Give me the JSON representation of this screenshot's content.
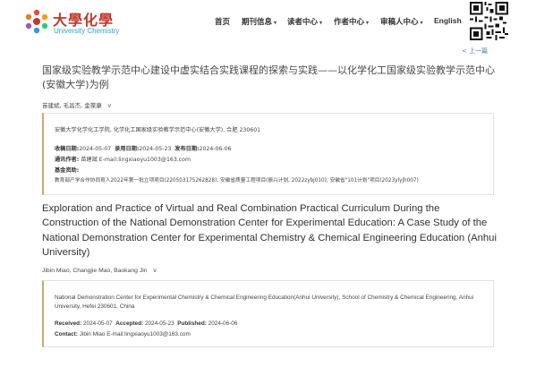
{
  "header": {
    "logo_cn": "大學化學",
    "logo_en": "University Chemistry",
    "nav": [
      {
        "label": "首页",
        "has_dropdown": false
      },
      {
        "label": "期刊信息",
        "has_dropdown": true
      },
      {
        "label": "读者中心",
        "has_dropdown": true
      },
      {
        "label": "作者中心",
        "has_dropdown": true
      },
      {
        "label": "审稿人中心",
        "has_dropdown": true
      },
      {
        "label": "English",
        "has_dropdown": false
      }
    ],
    "dropdown_caret": "▾",
    "prev_page": "< 上一篇"
  },
  "article_cn": {
    "title": "国家级实验教学示范中心建设中虚实结合实践课程的探索与实践——以化学化工国家级实验教学示范中心(安徽大学)为例",
    "authors": "苗建斌, 毛昌杰, 金葆康",
    "affiliation": "安徽大学化学化工学院, 化学化工国家级实验教学示范中心(安徽大学), 合肥 230601",
    "received_label": "收稿日期:",
    "received": "2024-05-07",
    "accepted_label": "录用日期:",
    "accepted": "2024-05-23",
    "published_label": "发布日期:",
    "published": "2024-06-06",
    "contact_label": "通讯作者:",
    "contact": "苗建斌 E-mail:lingxiaoyu1003@163.com",
    "funding_label": "基金资助:",
    "funding": "教育部产学合作协同育人2022年第一批立项项目(220503175262828); 安徽省质量工程项目(振兴计划, 2022zybj010); 安徽省\"101计划\"项目(2023ylyjh007)"
  },
  "article_en": {
    "title": "Exploration and Practice of Virtual and Real Combination Practical Curriculum During the Construction of the National Demonstration Center for Experimental Education: A Case Study of the National Demonstration Center for Experimental Chemistry & Chemical Engineering Education (Anhui University)",
    "authors": "Jibin Miao, Changjie Mao, Baokang Jin",
    "affiliation": "National Demonstration Center for Experimental Chemistry & Chemical Engineering Education(Anhui University), School of Chemistry & Chemical Engineering, Anhui University, Hefei 230601, China",
    "received_label": "Received:",
    "received": "2024-05-07",
    "accepted_label": "Accepted:",
    "accepted": "2024-05-23",
    "published_label": "Published:",
    "published": "2024-06-06",
    "contact_label": "Contact:",
    "contact": "Jibin Miao E-mail:lingxiaoyu1003@163.com"
  },
  "icons": {
    "expand_chevron": "∨"
  },
  "colors": {
    "logo_red": "#c0392b",
    "logo_blue": "#2ea4c8",
    "link_blue": "#4a7db5",
    "box_accent": "#c9a96e"
  }
}
